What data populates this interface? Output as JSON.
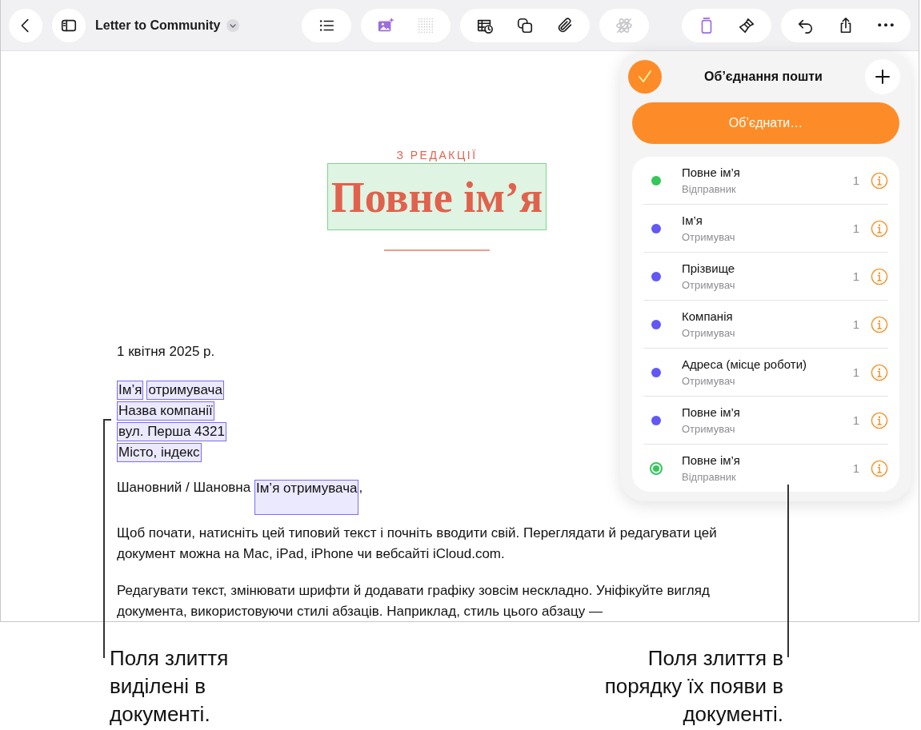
{
  "toolbar": {
    "left": [
      {
        "kind": "back",
        "active": false,
        "disabled": false
      },
      {
        "kind": "sidebar",
        "active": false,
        "disabled": false
      }
    ],
    "title": "Letter to Community",
    "center": [
      [
        {
          "kind": "list",
          "active": false,
          "disabled": false
        }
      ],
      [
        {
          "kind": "image",
          "active": true,
          "disabled": false
        },
        {
          "kind": "grid",
          "active": false,
          "disabled": true
        }
      ],
      [
        {
          "kind": "table-chart",
          "active": false,
          "disabled": false
        },
        {
          "kind": "shapes",
          "active": false,
          "disabled": false
        },
        {
          "kind": "paperclip",
          "active": false,
          "disabled": false
        }
      ],
      [
        {
          "kind": "atom",
          "active": false,
          "disabled": true
        }
      ]
    ],
    "right": [
      [
        {
          "kind": "document",
          "active": true,
          "disabled": false
        },
        {
          "kind": "brush",
          "active": false,
          "disabled": false
        }
      ],
      [
        {
          "kind": "undo",
          "active": false,
          "disabled": false
        },
        {
          "kind": "share",
          "active": false,
          "disabled": false
        },
        {
          "kind": "more",
          "active": false,
          "disabled": false
        }
      ]
    ]
  },
  "document": {
    "eyebrow": "З РЕДАКЦІЇ",
    "heading": {
      "text": "Повне ім’я",
      "color": "#7fd48e"
    },
    "date": "1 квітня 2025 р.",
    "address": [
      [
        {
          "text": "Ім’я",
          "color": "#7b6cf6"
        },
        {
          "text": "отримувача",
          "color": "#7b6cf6"
        }
      ],
      [
        {
          "text": "Назва компанії",
          "color": "#7b6cf6"
        }
      ],
      [
        {
          "text": "вул. Перша 4321",
          "color": "#7b6cf6"
        }
      ],
      [
        {
          "text": "Місто, індекс",
          "color": "#7b6cf6"
        }
      ]
    ],
    "greeting": [
      {
        "text": "Шановний / Шановна "
      },
      {
        "text": "Ім’я отримувача",
        "color": "#7b6cf6"
      },
      {
        "text": ","
      }
    ],
    "paragraphs": [
      "Щоб почати, натисніть цей типовий текст і почніть вводити свій. Переглядати й редагувати цей документ можна на Mac, iPad, iPhone чи вебсайті iCloud.com.",
      "Редагувати текст, змінювати шрифти й додавати графіку зовсім нескладно. Уніфікуйте вигляд документа, використовуючи стилі абзаців. Наприклад, стиль цього абзацу —"
    ]
  },
  "panel": {
    "title": "Об’єднання пошти",
    "done": {
      "checked": true
    },
    "merge_button": "Об’єднати…",
    "fields": [
      {
        "name": "Повне ім’я",
        "role": "Відправник",
        "count": "1",
        "color": "#34c759",
        "selected": false
      },
      {
        "name": "Ім’я",
        "role": "Отримувач",
        "count": "1",
        "color": "#6258f5",
        "selected": false
      },
      {
        "name": "Прізвище",
        "role": "Отримувач",
        "count": "1",
        "color": "#6258f5",
        "selected": false
      },
      {
        "name": "Компанія",
        "role": "Отримувач",
        "count": "1",
        "color": "#6258f5",
        "selected": false
      },
      {
        "name": "Адреса (місце роботи)",
        "role": "Отримувач",
        "count": "1",
        "color": "#6258f5",
        "selected": false
      },
      {
        "name": "Повне ім’я",
        "role": "Отримувач",
        "count": "1",
        "color": "#6258f5",
        "selected": false
      },
      {
        "name": "Повне ім’я",
        "role": "Відправник",
        "count": "1",
        "color": "#34c759",
        "selected": true
      }
    ]
  },
  "callouts": [
    {
      "text": "Поля злиття\nвиділені в\nдокументі."
    },
    {
      "text": "Поля злиття в\nпорядку їх появи в\nдокументі."
    }
  ]
}
